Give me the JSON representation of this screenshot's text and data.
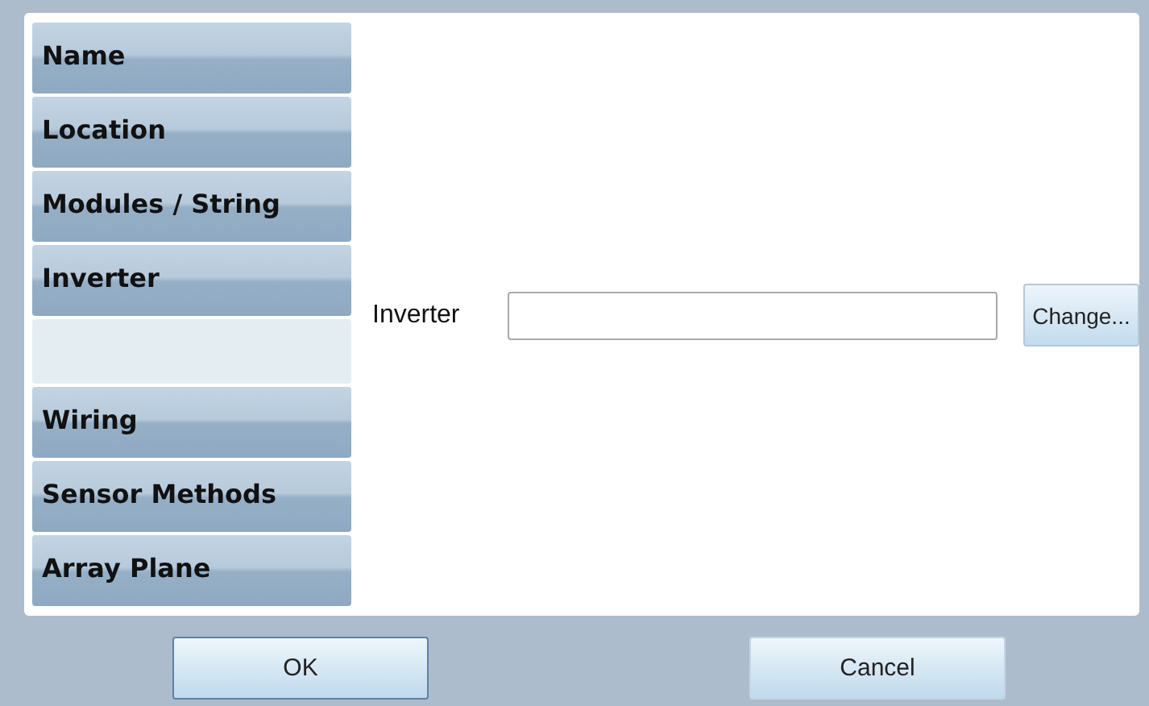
{
  "sections": [
    {
      "label": "Name",
      "expanded": false
    },
    {
      "label": "Location",
      "expanded": false
    },
    {
      "label": "Modules / String",
      "expanded": false
    },
    {
      "label": "Inverter",
      "expanded": true
    },
    {
      "label": "Wiring",
      "expanded": false
    },
    {
      "label": "Sensor Methods",
      "expanded": false
    },
    {
      "label": "Array Plane",
      "expanded": false
    }
  ],
  "field": {
    "label": "Inverter",
    "button": "Change..."
  },
  "buttons": [
    "OK",
    "Cancel"
  ]
}
